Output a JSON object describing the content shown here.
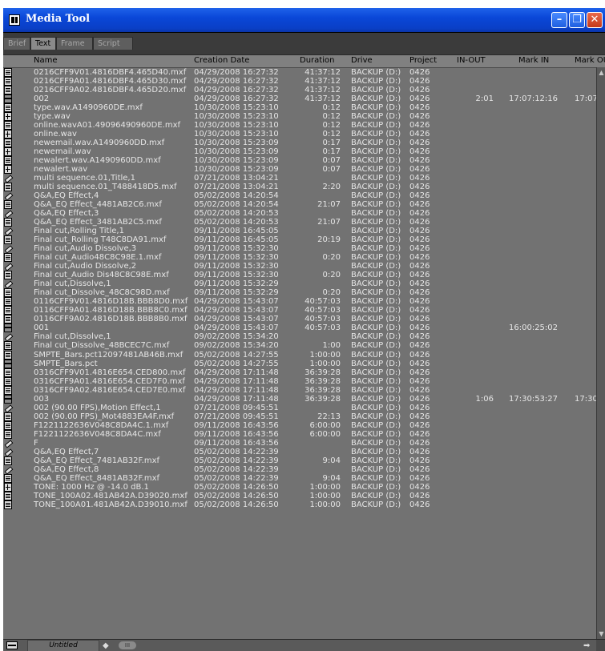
{
  "window": {
    "title": "Media Tool",
    "buttons": {
      "minimize": "–",
      "maximize": "❐",
      "close": "✕"
    }
  },
  "tabs": [
    "Brief",
    "Text",
    "Frame",
    "Script"
  ],
  "active_tab": "Text",
  "columns": [
    "Name",
    "Creation Date",
    "Duration",
    "Drive",
    "Project",
    "IN-OUT",
    "Mark IN",
    "Mark OUT"
  ],
  "rows": [
    {
      "icon": "clip",
      "name": "0216CFF9V01.4816DBF4.465D40.mxf",
      "date": "04/29/2008 16:27:32",
      "duration": "41:37:12",
      "drive": "BACKUP (D:)",
      "project": "0426",
      "inout": "",
      "markin": "",
      "markout": ""
    },
    {
      "icon": "clip",
      "name": "0216CFF9A01.4816DBF4.465D30.mxf",
      "date": "04/29/2008 16:27:32",
      "duration": "41:37:12",
      "drive": "BACKUP (D:)",
      "project": "0426",
      "inout": "",
      "markin": "",
      "markout": ""
    },
    {
      "icon": "clip",
      "name": "0216CFF9A02.4816DBF4.465D20.mxf",
      "date": "04/29/2008 16:27:32",
      "duration": "41:37:12",
      "drive": "BACKUP (D:)",
      "project": "0426",
      "inout": "",
      "markin": "",
      "markout": ""
    },
    {
      "icon": "seq",
      "name": "002",
      "date": "04/29/2008 16:27:32",
      "duration": "41:37:12",
      "drive": "BACKUP (D:)",
      "project": "0426",
      "inout": "2:01",
      "markin": "17:07:12:16",
      "markout": "17:07:"
    },
    {
      "icon": "clip",
      "name": "type.wav.A1490960DE.mxf",
      "date": "10/30/2008 15:23:10",
      "duration": "0:12",
      "drive": "BACKUP (D:)",
      "project": "0426",
      "inout": "",
      "markin": "",
      "markout": ""
    },
    {
      "icon": "audio",
      "name": "type.wav",
      "date": "10/30/2008 15:23:10",
      "duration": "0:12",
      "drive": "BACKUP (D:)",
      "project": "0426",
      "inout": "",
      "markin": "",
      "markout": ""
    },
    {
      "icon": "clip",
      "name": "online.wavA01.49096490960DE.mxf",
      "date": "10/30/2008 15:23:10",
      "duration": "0:12",
      "drive": "BACKUP (D:)",
      "project": "0426",
      "inout": "",
      "markin": "",
      "markout": ""
    },
    {
      "icon": "audio",
      "name": "online.wav",
      "date": "10/30/2008 15:23:10",
      "duration": "0:12",
      "drive": "BACKUP (D:)",
      "project": "0426",
      "inout": "",
      "markin": "",
      "markout": ""
    },
    {
      "icon": "clip",
      "name": "newemail.wav.A1490960DD.mxf",
      "date": "10/30/2008 15:23:09",
      "duration": "0:17",
      "drive": "BACKUP (D:)",
      "project": "0426",
      "inout": "",
      "markin": "",
      "markout": ""
    },
    {
      "icon": "audio",
      "name": "newemail.wav",
      "date": "10/30/2008 15:23:09",
      "duration": "0:17",
      "drive": "BACKUP (D:)",
      "project": "0426",
      "inout": "",
      "markin": "",
      "markout": ""
    },
    {
      "icon": "clip",
      "name": "newalert.wav.A1490960DD.mxf",
      "date": "10/30/2008 15:23:09",
      "duration": "0:07",
      "drive": "BACKUP (D:)",
      "project": "0426",
      "inout": "",
      "markin": "",
      "markout": ""
    },
    {
      "icon": "audio",
      "name": "newalert.wav",
      "date": "10/30/2008 15:23:09",
      "duration": "0:07",
      "drive": "BACKUP (D:)",
      "project": "0426",
      "inout": "",
      "markin": "",
      "markout": ""
    },
    {
      "icon": "effect",
      "name": "multi sequence.01,Title,1",
      "date": "07/21/2008 13:04:21",
      "duration": "",
      "drive": "BACKUP (D:)",
      "project": "0426",
      "inout": "",
      "markin": "",
      "markout": ""
    },
    {
      "icon": "clip",
      "name": "multi sequence.01_T488418D5.mxf",
      "date": "07/21/2008 13:04:21",
      "duration": "2:20",
      "drive": "BACKUP (D:)",
      "project": "0426",
      "inout": "",
      "markin": "",
      "markout": ""
    },
    {
      "icon": "effect",
      "name": "Q&A,EQ Effect,4",
      "date": "05/02/2008 14:20:54",
      "duration": "",
      "drive": "BACKUP (D:)",
      "project": "0426",
      "inout": "",
      "markin": "",
      "markout": ""
    },
    {
      "icon": "clip",
      "name": "Q&A_EQ Effect_4481AB2C6.mxf",
      "date": "05/02/2008 14:20:54",
      "duration": "21:07",
      "drive": "BACKUP (D:)",
      "project": "0426",
      "inout": "",
      "markin": "",
      "markout": ""
    },
    {
      "icon": "effect",
      "name": "Q&A,EQ Effect,3",
      "date": "05/02/2008 14:20:53",
      "duration": "",
      "drive": "BACKUP (D:)",
      "project": "0426",
      "inout": "",
      "markin": "",
      "markout": ""
    },
    {
      "icon": "clip",
      "name": "Q&A_EQ Effect_3481AB2C5.mxf",
      "date": "05/02/2008 14:20:53",
      "duration": "21:07",
      "drive": "BACKUP (D:)",
      "project": "0426",
      "inout": "",
      "markin": "",
      "markout": ""
    },
    {
      "icon": "effect",
      "name": "Final cut,Rolling Title,1",
      "date": "09/11/2008 16:45:05",
      "duration": "",
      "drive": "BACKUP (D:)",
      "project": "0426",
      "inout": "",
      "markin": "",
      "markout": ""
    },
    {
      "icon": "clip",
      "name": "Final cut_Rolling T48C8DA91.mxf",
      "date": "09/11/2008 16:45:05",
      "duration": "20:19",
      "drive": "BACKUP (D:)",
      "project": "0426",
      "inout": "",
      "markin": "",
      "markout": ""
    },
    {
      "icon": "effect",
      "name": "Final cut,Audio Dissolve,3",
      "date": "09/11/2008 15:32:30",
      "duration": "",
      "drive": "BACKUP (D:)",
      "project": "0426",
      "inout": "",
      "markin": "",
      "markout": ""
    },
    {
      "icon": "clip",
      "name": "Final cut_Audio48C8C98E.1.mxf",
      "date": "09/11/2008 15:32:30",
      "duration": "0:20",
      "drive": "BACKUP (D:)",
      "project": "0426",
      "inout": "",
      "markin": "",
      "markout": ""
    },
    {
      "icon": "effect",
      "name": "Final cut,Audio Dissolve,2",
      "date": "09/11/2008 15:32:30",
      "duration": "",
      "drive": "BACKUP (D:)",
      "project": "0426",
      "inout": "",
      "markin": "",
      "markout": ""
    },
    {
      "icon": "clip",
      "name": "Final cut_Audio Dis48C8C98E.mxf",
      "date": "09/11/2008 15:32:30",
      "duration": "0:20",
      "drive": "BACKUP (D:)",
      "project": "0426",
      "inout": "",
      "markin": "",
      "markout": ""
    },
    {
      "icon": "effect",
      "name": "Final cut,Dissolve,1",
      "date": "09/11/2008 15:32:29",
      "duration": "",
      "drive": "BACKUP (D:)",
      "project": "0426",
      "inout": "",
      "markin": "",
      "markout": ""
    },
    {
      "icon": "clip",
      "name": "Final cut_Dissolve_48C8C98D.mxf",
      "date": "09/11/2008 15:32:29",
      "duration": "0:20",
      "drive": "BACKUP (D:)",
      "project": "0426",
      "inout": "",
      "markin": "",
      "markout": ""
    },
    {
      "icon": "clip",
      "name": "0116CFF9V01.4816D18B.BBB8D0.mxf",
      "date": "04/29/2008 15:43:07",
      "duration": "40:57:03",
      "drive": "BACKUP (D:)",
      "project": "0426",
      "inout": "",
      "markin": "",
      "markout": ""
    },
    {
      "icon": "clip",
      "name": "0116CFF9A01.4816D18B.BBB8C0.mxf",
      "date": "04/29/2008 15:43:07",
      "duration": "40:57:03",
      "drive": "BACKUP (D:)",
      "project": "0426",
      "inout": "",
      "markin": "",
      "markout": ""
    },
    {
      "icon": "clip",
      "name": "0116CFF9A02.4816D18B.BBB8B0.mxf",
      "date": "04/29/2008 15:43:07",
      "duration": "40:57:03",
      "drive": "BACKUP (D:)",
      "project": "0426",
      "inout": "",
      "markin": "",
      "markout": ""
    },
    {
      "icon": "seq",
      "name": "001",
      "date": "04/29/2008 15:43:07",
      "duration": "40:57:03",
      "drive": "BACKUP (D:)",
      "project": "0426",
      "inout": "",
      "markin": "16:00:25:02",
      "markout": ""
    },
    {
      "icon": "effect",
      "name": "Final cut,Dissolve,1",
      "date": "09/02/2008 15:34:20",
      "duration": "",
      "drive": "BACKUP (D:)",
      "project": "0426",
      "inout": "",
      "markin": "",
      "markout": ""
    },
    {
      "icon": "clip",
      "name": "Final cut_Dissolve_48BCEC7C.mxf",
      "date": "09/02/2008 15:34:20",
      "duration": "1:00",
      "drive": "BACKUP (D:)",
      "project": "0426",
      "inout": "",
      "markin": "",
      "markout": ""
    },
    {
      "icon": "clip",
      "name": "SMPTE_Bars.pct12097481AB46B.mxf",
      "date": "05/02/2008 14:27:55",
      "duration": "1:00:00",
      "drive": "BACKUP (D:)",
      "project": "0426",
      "inout": "",
      "markin": "",
      "markout": ""
    },
    {
      "icon": "seq",
      "name": "SMPTE_Bars.pct",
      "date": "05/02/2008 14:27:55",
      "duration": "1:00:00",
      "drive": "BACKUP (D:)",
      "project": "0426",
      "inout": "",
      "markin": "",
      "markout": ""
    },
    {
      "icon": "clip",
      "name": "0316CFF9V01.4816E654.CED800.mxf",
      "date": "04/29/2008 17:11:48",
      "duration": "36:39:28",
      "drive": "BACKUP (D:)",
      "project": "0426",
      "inout": "",
      "markin": "",
      "markout": ""
    },
    {
      "icon": "clip",
      "name": "0316CFF9A01.4816E654.CED7F0.mxf",
      "date": "04/29/2008 17:11:48",
      "duration": "36:39:28",
      "drive": "BACKUP (D:)",
      "project": "0426",
      "inout": "",
      "markin": "",
      "markout": ""
    },
    {
      "icon": "clip",
      "name": "0316CFF9A02.4816E654.CED7E0.mxf",
      "date": "04/29/2008 17:11:48",
      "duration": "36:39:28",
      "drive": "BACKUP (D:)",
      "project": "0426",
      "inout": "",
      "markin": "",
      "markout": ""
    },
    {
      "icon": "seq",
      "name": "003",
      "date": "04/29/2008 17:11:48",
      "duration": "36:39:28",
      "drive": "BACKUP (D:)",
      "project": "0426",
      "inout": "1:06",
      "markin": "17:30:53:27",
      "markout": "17:30:"
    },
    {
      "icon": "effect",
      "name": "002 (90.00 FPS),Motion Effect,1",
      "date": "07/21/2008 09:45:51",
      "duration": "",
      "drive": "BACKUP (D:)",
      "project": "0426",
      "inout": "",
      "markin": "",
      "markout": ""
    },
    {
      "icon": "clip",
      "name": "002 (90.00 FPS)_Mot4883EA4F.mxf",
      "date": "07/21/2008 09:45:51",
      "duration": "22:13",
      "drive": "BACKUP (D:)",
      "project": "0426",
      "inout": "",
      "markin": "",
      "markout": ""
    },
    {
      "icon": "clip",
      "name": "F1221122636V048C8DA4C.1.mxf",
      "date": "09/11/2008 16:43:56",
      "duration": "6:00:00",
      "drive": "BACKUP (D:)",
      "project": "0426",
      "inout": "",
      "markin": "",
      "markout": ""
    },
    {
      "icon": "clip",
      "name": "F1221122636V048C8DA4C.mxf",
      "date": "09/11/2008 16:43:56",
      "duration": "6:00:00",
      "drive": "BACKUP (D:)",
      "project": "0426",
      "inout": "",
      "markin": "",
      "markout": ""
    },
    {
      "icon": "effect",
      "name": "F",
      "date": "09/11/2008 16:43:56",
      "duration": "",
      "drive": "BACKUP (D:)",
      "project": "0426",
      "inout": "",
      "markin": "",
      "markout": ""
    },
    {
      "icon": "effect",
      "name": "Q&A,EQ Effect,7",
      "date": "05/02/2008 14:22:39",
      "duration": "",
      "drive": "BACKUP (D:)",
      "project": "0426",
      "inout": "",
      "markin": "",
      "markout": ""
    },
    {
      "icon": "clip",
      "name": "Q&A_EQ Effect_7481AB32F.mxf",
      "date": "05/02/2008 14:22:39",
      "duration": "9:04",
      "drive": "BACKUP (D:)",
      "project": "0426",
      "inout": "",
      "markin": "",
      "markout": ""
    },
    {
      "icon": "effect",
      "name": "Q&A,EQ Effect,8",
      "date": "05/02/2008 14:22:39",
      "duration": "",
      "drive": "BACKUP (D:)",
      "project": "0426",
      "inout": "",
      "markin": "",
      "markout": ""
    },
    {
      "icon": "clip",
      "name": "Q&A_EQ Effect_8481AB32F.mxf",
      "date": "05/02/2008 14:22:39",
      "duration": "9:04",
      "drive": "BACKUP (D:)",
      "project": "0426",
      "inout": "",
      "markin": "",
      "markout": ""
    },
    {
      "icon": "audio",
      "name": "TONE: 1000 Hz @ -14.0 dB.1",
      "date": "05/02/2008 14:26:50",
      "duration": "1:00:00",
      "drive": "BACKUP (D:)",
      "project": "0426",
      "inout": "",
      "markin": "",
      "markout": ""
    },
    {
      "icon": "clip",
      "name": "TONE_100A02.481AB42A.D39020.mxf",
      "date": "05/02/2008 14:26:50",
      "duration": "1:00:00",
      "drive": "BACKUP (D:)",
      "project": "0426",
      "inout": "",
      "markin": "",
      "markout": ""
    },
    {
      "icon": "clip",
      "name": "TONE_100A01.481AB42A.D39010.mxf",
      "date": "05/02/2008 14:26:50",
      "duration": "1:00:00",
      "drive": "BACKUP (D:)",
      "project": "0426",
      "inout": "",
      "markin": "",
      "markout": ""
    }
  ],
  "statusbar": {
    "bin_name": "Untitled",
    "scroll_left": "◆",
    "scroll_thumb": "III",
    "scroll_right": "➡"
  },
  "scrollbar": {
    "up": "▲",
    "down": "▼"
  }
}
